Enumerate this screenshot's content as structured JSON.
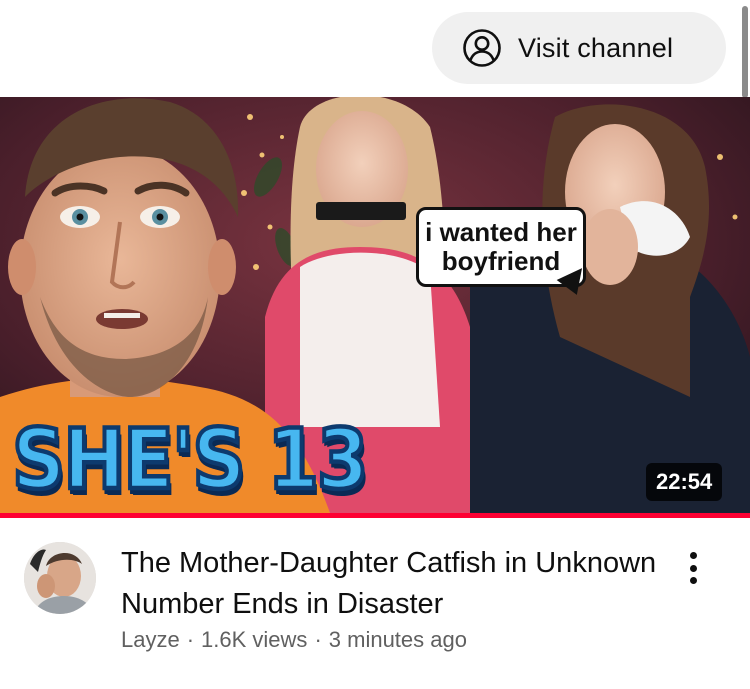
{
  "header": {
    "visit_channel_label": "Visit channel",
    "visit_channel_icon": "account-circle-icon"
  },
  "video": {
    "thumbnail": {
      "speech_bubble_line1": "i wanted her",
      "speech_bubble_line2": "boyfriend",
      "overlay_text": "SHE'S 13",
      "overlay_color": "#47b7f0"
    },
    "duration": "22:54",
    "progress_color": "#ff0033",
    "title": "The Mother-Daughter Catfish in Unknown Number Ends in Disaster",
    "channel": "Layze",
    "views": "1.6K views",
    "age": "3 minutes ago",
    "meta_separator": "·",
    "menu_icon": "more-vert-icon"
  }
}
